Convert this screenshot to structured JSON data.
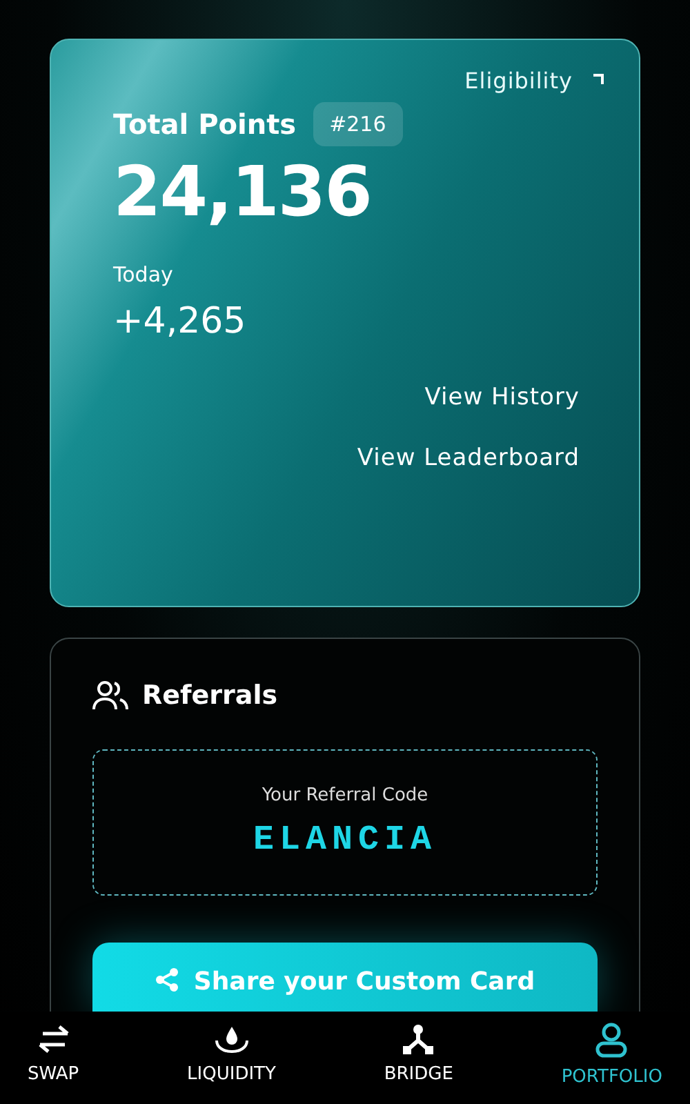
{
  "points_card": {
    "eligibility": "Eligibility",
    "title": "Total Points",
    "rank": "#216",
    "total": "24,136",
    "today_label": "Today",
    "today_value": "+4,265",
    "links": [
      "View History",
      "View Leaderboard"
    ]
  },
  "referrals": {
    "title": "Referrals",
    "code_label": "Your Referral Code",
    "code": "ELANCIA",
    "share_button": "Share your Custom Card"
  },
  "nav": [
    {
      "kind": "swap",
      "label": "SWAP",
      "selected": false
    },
    {
      "kind": "liquidity",
      "label": "LIQUIDITY",
      "selected": false
    },
    {
      "kind": "bridge",
      "label": "BRIDGE",
      "selected": false
    },
    {
      "kind": "portfolio",
      "label": "PORTFOLIO",
      "selected": true
    }
  ]
}
